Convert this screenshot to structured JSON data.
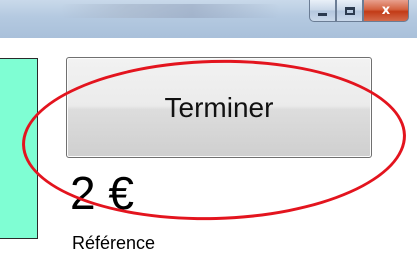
{
  "window": {
    "controls": {
      "minimize_icon": "minimize-icon",
      "maximize_icon": "maximize-icon",
      "close_icon": "close-icon",
      "close_glyph": "x"
    }
  },
  "main": {
    "terminer_label": "Terminer",
    "price": "2 €",
    "reference_label": "Référence"
  },
  "colors": {
    "panel_accent": "#7ffed3",
    "annotation": "#e3141e"
  }
}
